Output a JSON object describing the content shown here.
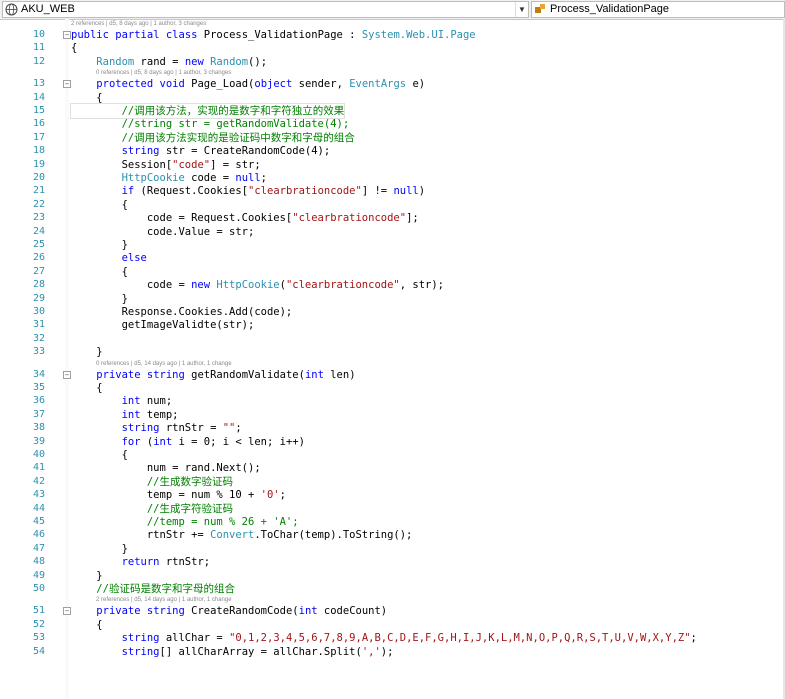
{
  "nav": {
    "project": "AKU_WEB",
    "member": "Process_ValidationPage",
    "icons": [
      "globe-icon",
      "class-member-icon",
      "chevron-down-icon"
    ]
  },
  "editor": {
    "lens_class": "2 references | d5, 8 days ago | 1 author, 3 changes",
    "lens_pageload": "0 references | d5, 8 days ago | 1 author, 3 changes",
    "lens_getrandom": "0 references | d5, 14 days ago | 1 author, 1 change",
    "lens_createrandom": "2 references | d5, 14 days ago | 1 author, 1 change",
    "lines": [
      {
        "n": "10",
        "t": "public partial class Process_ValidationPage : System.Web.UI.Page"
      },
      {
        "n": "11",
        "t": "{"
      },
      {
        "n": "12",
        "t": "    Random rand = new Random();"
      },
      {
        "n": "13",
        "t": "    protected void Page_Load(object sender, EventArgs e)"
      },
      {
        "n": "14",
        "t": "    {"
      },
      {
        "n": "15",
        "t": "        //调用该方法，实现的是数字和字符独立的效果"
      },
      {
        "n": "16",
        "t": "        //string str = getRandomValidate(4);"
      },
      {
        "n": "17",
        "t": "        //调用该方法实现的是验证码中数字和字母的组合"
      },
      {
        "n": "18",
        "t": "        string str = CreateRandomCode(4);"
      },
      {
        "n": "19",
        "t": "        Session[\"code\"] = str;"
      },
      {
        "n": "20",
        "t": "        HttpCookie code = null;"
      },
      {
        "n": "21",
        "t": "        if (Request.Cookies[\"clearbrationcode\"] != null)"
      },
      {
        "n": "22",
        "t": "        {"
      },
      {
        "n": "23",
        "t": "            code = Request.Cookies[\"clearbrationcode\"];"
      },
      {
        "n": "24",
        "t": "            code.Value = str;"
      },
      {
        "n": "25",
        "t": "        }"
      },
      {
        "n": "26",
        "t": "        else"
      },
      {
        "n": "27",
        "t": "        {"
      },
      {
        "n": "28",
        "t": "            code = new HttpCookie(\"clearbrationcode\", str);"
      },
      {
        "n": "29",
        "t": "        }"
      },
      {
        "n": "30",
        "t": "        Response.Cookies.Add(code);"
      },
      {
        "n": "31",
        "t": "        getImageValidte(str);"
      },
      {
        "n": "32",
        "t": ""
      },
      {
        "n": "33",
        "t": "    }"
      },
      {
        "n": "34",
        "t": "    private string getRandomValidate(int len)"
      },
      {
        "n": "35",
        "t": "    {"
      },
      {
        "n": "36",
        "t": "        int num;"
      },
      {
        "n": "37",
        "t": "        int temp;"
      },
      {
        "n": "38",
        "t": "        string rtnStr = \"\";"
      },
      {
        "n": "39",
        "t": "        for (int i = 0; i < len; i++)"
      },
      {
        "n": "40",
        "t": "        {"
      },
      {
        "n": "41",
        "t": "            num = rand.Next();"
      },
      {
        "n": "42",
        "t": "            //生成数字验证码"
      },
      {
        "n": "43",
        "t": "            temp = num % 10 + '0';"
      },
      {
        "n": "44",
        "t": "            //生成字符验证码"
      },
      {
        "n": "45",
        "t": "            //temp = num % 26 + 'A';"
      },
      {
        "n": "46",
        "t": "            rtnStr += Convert.ToChar(temp).ToString();"
      },
      {
        "n": "47",
        "t": "        }"
      },
      {
        "n": "48",
        "t": "        return rtnStr;"
      },
      {
        "n": "49",
        "t": "    }"
      },
      {
        "n": "50",
        "t": "    //验证码是数字和字母的组合"
      },
      {
        "n": "51",
        "t": "    private string CreateRandomCode(int codeCount)"
      },
      {
        "n": "52",
        "t": "    {"
      },
      {
        "n": "53",
        "t": "        string allChar = \"0,1,2,3,4,5,6,7,8,9,A,B,C,D,E,F,G,H,I,J,K,L,M,N,O,P,Q,R,S,T,U,V,W,X,Y,Z\";"
      },
      {
        "n": "54",
        "t": "        string[] allCharArray = allChar.Split(',');"
      }
    ]
  }
}
